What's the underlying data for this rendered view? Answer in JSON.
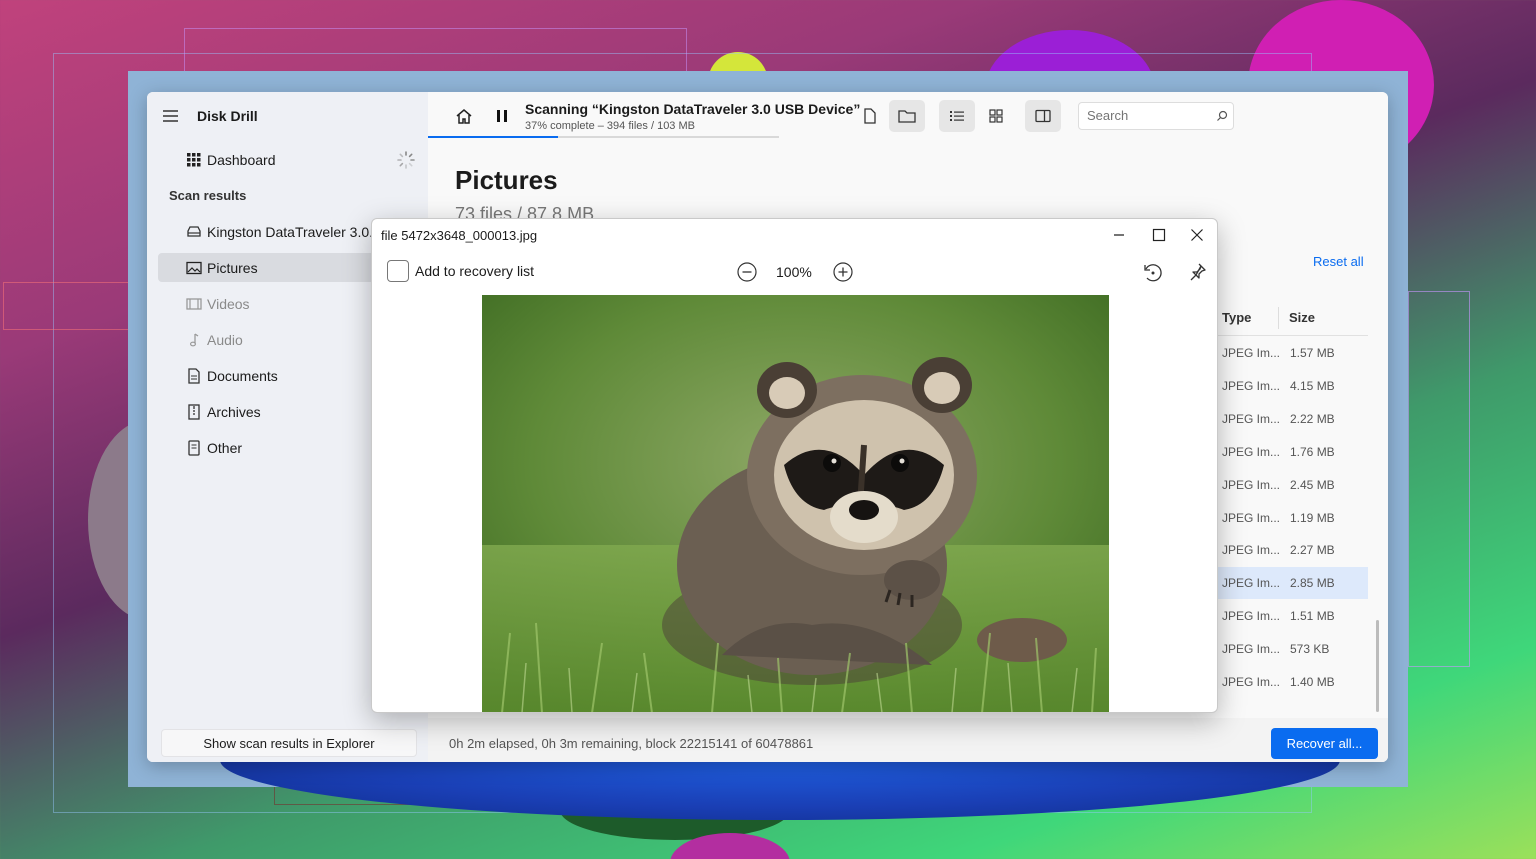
{
  "sidebar": {
    "app_title": "Disk Drill",
    "dashboard_label": "Dashboard",
    "scan_results_heading": "Scan results",
    "items": [
      {
        "label": "Kingston DataTraveler 3.0...",
        "icon": "drive-icon"
      },
      {
        "label": "Pictures",
        "icon": "image-icon"
      },
      {
        "label": "Videos",
        "icon": "film-icon"
      },
      {
        "label": "Audio",
        "icon": "music-note-icon"
      },
      {
        "label": "Documents",
        "icon": "document-icon"
      },
      {
        "label": "Archives",
        "icon": "archive-icon"
      },
      {
        "label": "Other",
        "icon": "file-icon"
      }
    ],
    "show_in_explorer_label": "Show scan results in Explorer"
  },
  "toolbar": {
    "scan_title": "Scanning “Kingston DataTraveler 3.0 USB Device”",
    "scan_status": "37% complete – 394 files / 103 MB",
    "scan_progress": 0.37,
    "search_placeholder": "Search"
  },
  "main": {
    "title": "Pictures",
    "subtitle": "73 files / 87.8 MB",
    "reset_all_label": "Reset all",
    "columns": {
      "type": "Type",
      "size": "Size"
    },
    "rows": [
      {
        "type": "JPEG Im...",
        "size": "1.57 MB"
      },
      {
        "type": "JPEG Im...",
        "size": "4.15 MB"
      },
      {
        "type": "JPEG Im...",
        "size": "2.22 MB"
      },
      {
        "type": "JPEG Im...",
        "size": "1.76 MB"
      },
      {
        "type": "JPEG Im...",
        "size": "2.45 MB"
      },
      {
        "type": "JPEG Im...",
        "size": "1.19 MB"
      },
      {
        "type": "JPEG Im...",
        "size": "2.27 MB"
      },
      {
        "type": "JPEG Im...",
        "size": "2.85 MB",
        "selected": true
      },
      {
        "type": "JPEG Im...",
        "size": "1.51 MB"
      },
      {
        "type": "JPEG Im...",
        "size": "573 KB"
      },
      {
        "type": "JPEG Im...",
        "size": "1.40 MB"
      }
    ],
    "status_text": "0h 2m elapsed, 0h 3m remaining, block 22215141 of 60478861",
    "recover_all_label": "Recover all..."
  },
  "viewer": {
    "title": "file 5472x3648_000013.jpg",
    "add_to_recovery_label": "Add to recovery list",
    "zoom_label": "100%"
  },
  "colors": {
    "accent": "#0a6cf0",
    "selected_row": "#dde9fb",
    "sidebar_bg": "#eef0f5"
  }
}
